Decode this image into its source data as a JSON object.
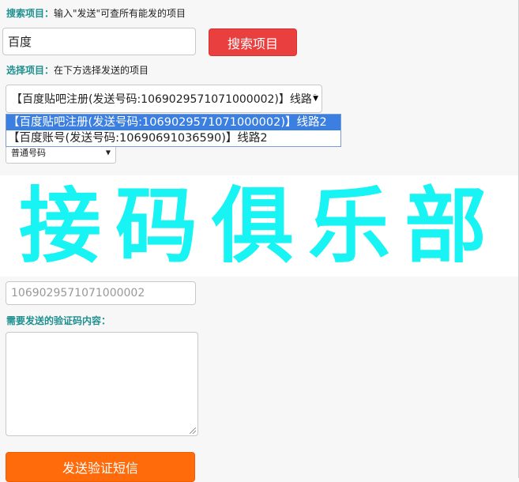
{
  "search": {
    "label_key": "搜索项目：",
    "label_hint": "输入\"发送\"可查所有能发的项目",
    "input_value": "百度",
    "button_label": "搜索项目"
  },
  "choose": {
    "label_key": "选择项目：",
    "label_hint": "在下方选择发送的项目",
    "selected_value": "【百度贴吧注册(发送号码:1069029571071000002)】线路2",
    "options": [
      "【百度贴吧注册(发送号码:1069029571071000002)】线路2",
      "【百度账号(发送号码:10690691036590)】线路2"
    ]
  },
  "number_type": {
    "selected_value": "普通号码"
  },
  "watermark": {
    "text": "接码俱乐部"
  },
  "send_number": {
    "value": "1069029571071000002"
  },
  "content": {
    "label_key": "需要发送的验证码内容："
  },
  "submit": {
    "button_label": "发送验证短信"
  },
  "colors": {
    "label_accent": "#1f8f8f",
    "search_button": "#e9403f",
    "submit_button": "#ff6a0a",
    "dropdown_selected": "#3b7fe0",
    "watermark": "#18f4f4"
  }
}
